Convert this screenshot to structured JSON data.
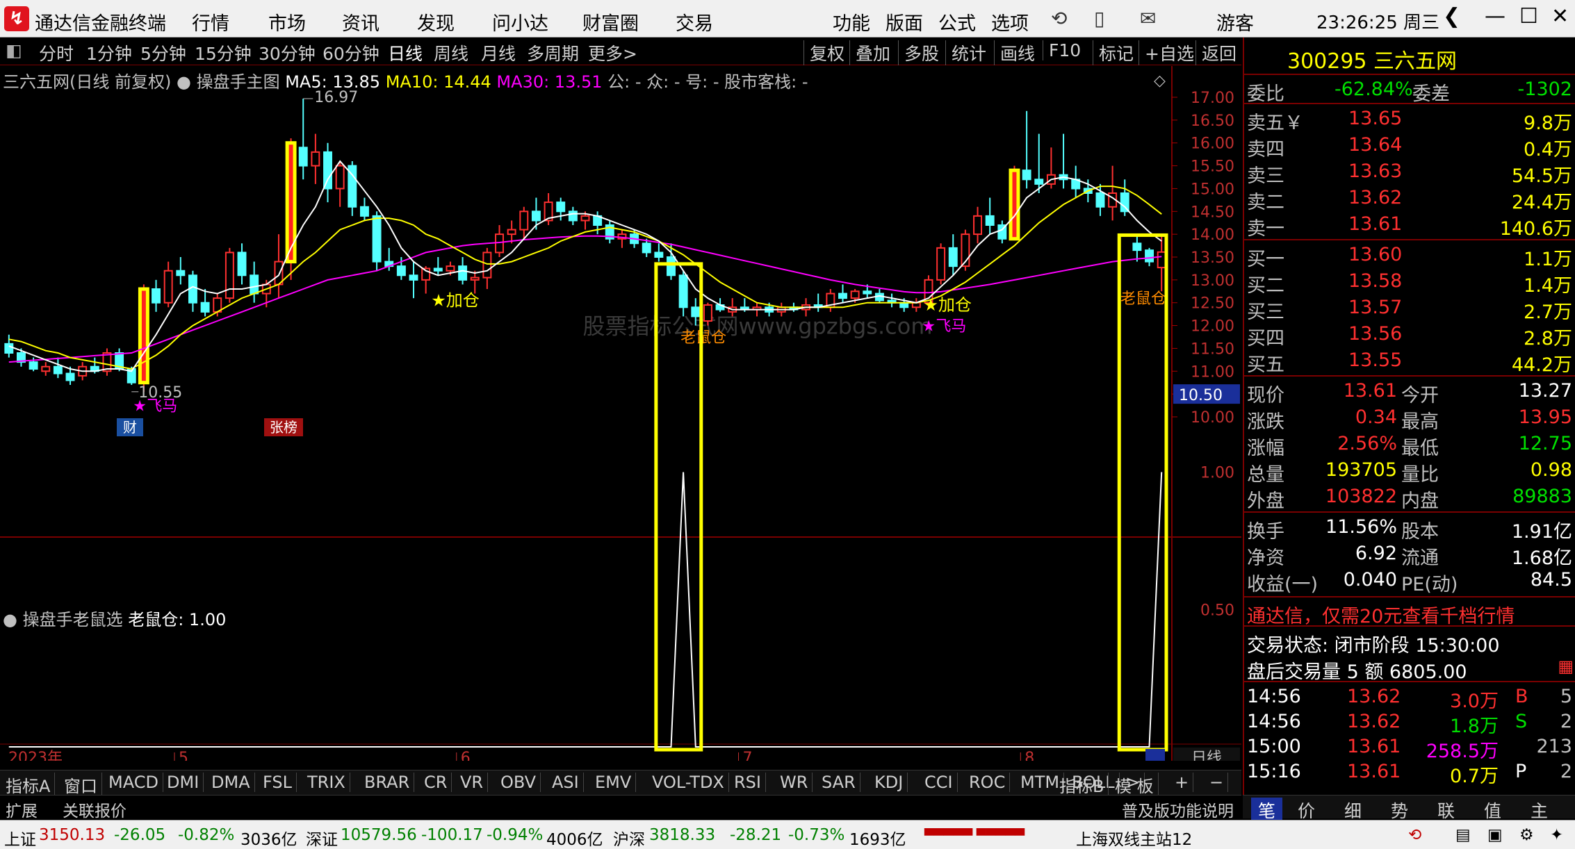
{
  "window": {
    "app_title": "通达信金融终端",
    "clock": "23:26:25 周三",
    "user": "游客"
  },
  "menu": {
    "left": [
      "行情",
      "市场",
      "资讯",
      "发现",
      "问小达",
      "财富圈",
      "交易"
    ],
    "right": [
      "功能",
      "版面",
      "公式",
      "选项"
    ]
  },
  "periods": [
    "分时",
    "1分钟",
    "5分钟",
    "15分钟",
    "30分钟",
    "60分钟",
    "日线",
    "周线",
    "月线",
    "多周期",
    "更多>"
  ],
  "active_period": "日线",
  "tools": [
    "复权",
    "叠加",
    "多股",
    "统计",
    "画线",
    "F10",
    "标记",
    "+自选",
    "返回"
  ],
  "info": {
    "name": "三六五网(日线 前复权)",
    "formula": "操盘手主图",
    "ma5": "MA5: 13.85",
    "ma10": "MA10: 14.44",
    "ma30": "MA30: 13.51",
    "extra": "公: - 众: - 号: - 股市客栈: -"
  },
  "sub_info": {
    "formula": "操盘手老鼠选",
    "value": "老鼠仓: 1.00"
  },
  "annotations": {
    "high_label": "16.97",
    "low_label": "10.55",
    "jiacang1": "★加仓",
    "jiacang2": "★加仓",
    "feima1": "飞马",
    "feima2": "飞马",
    "laoshu1": "老鼠仓",
    "laoshu2": "老鼠仓",
    "cai": "财",
    "zhangbang": "张榜",
    "watermark": "股票指标公式网www.gpzbgs.com",
    "current_price_tag": "10.50"
  },
  "price_axis": [
    "17.00",
    "16.50",
    "16.00",
    "15.50",
    "15.00",
    "14.50",
    "14.00",
    "13.50",
    "13.00",
    "12.50",
    "12.00",
    "11.50",
    "11.00",
    "10.50",
    "10.00"
  ],
  "sub_axis": [
    "1.00",
    "0.50"
  ],
  "date_axis": {
    "year": "2023年",
    "months": [
      "5",
      "6",
      "7",
      "8"
    ],
    "period_label": "日线"
  },
  "bottom_tabs": [
    "指标A",
    "窗口",
    "MACD",
    "DMI",
    "DMA",
    "FSL",
    "TRIX",
    "BRAR",
    "CR",
    "VR",
    "OBV",
    "ASI",
    "EMV",
    "VOL-TDX",
    "RSI",
    "WR",
    "SAR",
    "KDJ",
    "CCI",
    "ROC",
    "MTM",
    "BOLL",
    ">",
    "指标B",
    "模 板",
    "+",
    "−"
  ],
  "ext_bar": {
    "left": "扩展",
    "related": "关联报价",
    "right": "普及版功能说明"
  },
  "quote": {
    "code_name": "300295 三六五网",
    "weibi": {
      "label": "委比",
      "value": "-62.84%",
      "weicha_label": "委差",
      "weicha": "-1302"
    },
    "sells": [
      {
        "label": "卖五￥",
        "price": "13.65",
        "vol": "9.8万"
      },
      {
        "label": "卖四",
        "price": "13.64",
        "vol": "0.4万"
      },
      {
        "label": "卖三",
        "price": "13.63",
        "vol": "54.5万"
      },
      {
        "label": "卖二",
        "price": "13.62",
        "vol": "24.4万"
      },
      {
        "label": "卖一",
        "price": "13.61",
        "vol": "140.6万"
      }
    ],
    "buys": [
      {
        "label": "买一",
        "price": "13.60",
        "vol": "1.1万"
      },
      {
        "label": "买二",
        "price": "13.58",
        "vol": "1.4万"
      },
      {
        "label": "买三",
        "price": "13.57",
        "vol": "2.7万"
      },
      {
        "label": "买四",
        "price": "13.56",
        "vol": "2.8万"
      },
      {
        "label": "买五",
        "price": "13.55",
        "vol": "44.2万"
      }
    ],
    "stats": [
      {
        "l1": "现价",
        "v1": "13.61",
        "c1": "red",
        "l2": "今开",
        "v2": "13.27",
        "c2": "wht"
      },
      {
        "l1": "涨跌",
        "v1": "0.34",
        "c1": "red",
        "l2": "最高",
        "v2": "13.95",
        "c2": "red"
      },
      {
        "l1": "涨幅",
        "v1": "2.56%",
        "c1": "red",
        "l2": "最低",
        "v2": "12.75",
        "c2": "grn"
      },
      {
        "l1": "总量",
        "v1": "193705",
        "c1": "yel",
        "l2": "量比",
        "v2": "0.98",
        "c2": "yel"
      },
      {
        "l1": "外盘",
        "v1": "103822",
        "c1": "red",
        "l2": "内盘",
        "v2": "89883",
        "c2": "grn"
      }
    ],
    "stats2": [
      {
        "l1": "换手",
        "v1": "11.56%",
        "l2": "股本",
        "v2": "1.91亿"
      },
      {
        "l1": "净资",
        "v1": "6.92",
        "l2": "流通",
        "v2": "1.68亿"
      },
      {
        "l1": "收益(一)",
        "v1": "0.040",
        "l2": "PE(动)",
        "v2": "84.5"
      }
    ],
    "promo": "通达信，仅需20元查看千档行情",
    "trade_status": "交易状态: 闭市阶段 15:30:00",
    "after_hours": "盘后交易量 5 额 6805.00",
    "ticks": [
      {
        "time": "14:56",
        "price": "13.62",
        "vol": "3.0万",
        "dir": "B",
        "n": "5"
      },
      {
        "time": "14:56",
        "price": "13.62",
        "vol": "1.8万",
        "dir": "S",
        "n": "2"
      },
      {
        "time": "15:00",
        "price": "13.61",
        "vol": "258.5万",
        "dir": "",
        "n": "213"
      },
      {
        "time": "15:16",
        "price": "13.61",
        "vol": "0.7万",
        "dir": "P",
        "n": "2"
      }
    ]
  },
  "side_tabs": [
    "笔",
    "价",
    "细",
    "势",
    "联",
    "值",
    "主"
  ],
  "status": {
    "sh_label": "上证",
    "sh": "3150.13",
    "sh_chg": "-26.05",
    "sh_pct": "-0.82%",
    "sh_amt": "3036亿",
    "sz_label": "深证",
    "sz": "10579.56",
    "sz_chg": "-100.17",
    "sz_pct": "-0.94%",
    "sz_amt": "4006亿",
    "hs_label": "沪深",
    "hs": "3818.33",
    "hs_chg": "-28.21",
    "hs_pct": "-0.73%",
    "hs_amt": "1693亿",
    "server": "上海双线主站12"
  },
  "colors": {
    "up": "#ff3030",
    "down": "#54ffff",
    "ma5": "#ffffff",
    "ma10": "#ffff00",
    "ma30": "#ff00ff",
    "highlight": "#ffff00"
  },
  "chart_data": {
    "type": "candlestick",
    "price_range": [
      10.0,
      17.0
    ],
    "candles": [
      [
        11.6,
        11.8,
        11.3,
        11.4
      ],
      [
        11.4,
        11.5,
        11.1,
        11.2
      ],
      [
        11.2,
        11.3,
        11.0,
        11.05
      ],
      [
        11.0,
        11.2,
        10.9,
        11.1
      ],
      [
        11.1,
        11.3,
        10.85,
        10.95
      ],
      [
        10.95,
        11.1,
        10.7,
        10.8
      ],
      [
        10.9,
        11.2,
        10.8,
        11.1
      ],
      [
        11.1,
        11.3,
        10.95,
        11.0
      ],
      [
        11.0,
        11.5,
        10.9,
        11.4
      ],
      [
        11.4,
        11.5,
        11.0,
        11.05
      ],
      [
        11.05,
        11.1,
        10.7,
        10.75
      ],
      [
        10.75,
        12.9,
        10.55,
        12.8
      ],
      [
        12.8,
        13.0,
        12.3,
        12.5
      ],
      [
        12.5,
        13.4,
        12.4,
        13.2
      ],
      [
        13.2,
        13.5,
        12.9,
        13.1
      ],
      [
        13.1,
        13.2,
        12.3,
        12.5
      ],
      [
        12.5,
        12.8,
        12.2,
        12.3
      ],
      [
        12.3,
        12.7,
        12.2,
        12.6
      ],
      [
        12.6,
        13.7,
        12.5,
        13.6
      ],
      [
        13.6,
        13.8,
        12.9,
        13.1
      ],
      [
        13.1,
        13.4,
        12.5,
        12.7
      ],
      [
        12.7,
        13.0,
        12.4,
        12.9
      ],
      [
        12.9,
        14.0,
        12.6,
        13.4
      ],
      [
        13.4,
        16.1,
        13.0,
        16.0
      ],
      [
        15.9,
        16.97,
        15.2,
        15.5
      ],
      [
        15.5,
        16.2,
        15.1,
        15.8
      ],
      [
        15.8,
        16.0,
        14.7,
        15.0
      ],
      [
        15.0,
        15.6,
        14.6,
        15.5
      ],
      [
        15.5,
        15.6,
        14.4,
        14.6
      ],
      [
        14.6,
        14.8,
        14.3,
        14.4
      ],
      [
        14.4,
        14.5,
        13.2,
        13.4
      ],
      [
        13.4,
        13.7,
        13.2,
        13.3
      ],
      [
        13.3,
        13.5,
        13.0,
        13.1
      ],
      [
        13.1,
        13.4,
        12.6,
        13.0
      ],
      [
        13.0,
        13.3,
        12.7,
        13.25
      ],
      [
        13.25,
        13.5,
        13.1,
        13.2
      ],
      [
        13.2,
        13.4,
        13.1,
        13.3
      ],
      [
        13.3,
        13.5,
        12.9,
        13.0
      ],
      [
        13.0,
        13.2,
        12.7,
        13.05
      ],
      [
        13.05,
        13.7,
        12.8,
        13.6
      ],
      [
        13.6,
        14.2,
        13.5,
        14.0
      ],
      [
        14.0,
        14.3,
        13.8,
        14.1
      ],
      [
        14.1,
        14.6,
        13.9,
        14.5
      ],
      [
        14.5,
        14.8,
        14.1,
        14.3
      ],
      [
        14.3,
        14.9,
        14.2,
        14.7
      ],
      [
        14.7,
        14.8,
        14.3,
        14.5
      ],
      [
        14.5,
        14.6,
        14.2,
        14.3
      ],
      [
        14.3,
        14.5,
        14.1,
        14.4
      ],
      [
        14.4,
        14.5,
        14.0,
        14.2
      ],
      [
        14.2,
        14.3,
        13.8,
        13.9
      ],
      [
        13.9,
        14.1,
        13.7,
        14.0
      ],
      [
        14.0,
        14.1,
        13.7,
        13.8
      ],
      [
        13.8,
        13.9,
        13.5,
        13.6
      ],
      [
        13.6,
        13.8,
        13.4,
        13.5
      ],
      [
        13.5,
        13.8,
        13.0,
        13.1
      ],
      [
        13.1,
        13.2,
        12.2,
        12.4
      ],
      [
        12.4,
        12.6,
        12.0,
        12.2
      ],
      [
        12.1,
        12.5,
        12.0,
        12.45
      ],
      [
        12.45,
        12.6,
        12.3,
        12.35
      ],
      [
        12.3,
        12.6,
        12.2,
        12.4
      ],
      [
        12.4,
        12.6,
        12.3,
        12.35
      ],
      [
        12.35,
        12.5,
        12.2,
        12.4
      ],
      [
        12.4,
        12.5,
        12.2,
        12.3
      ],
      [
        12.3,
        12.5,
        12.2,
        12.4
      ],
      [
        12.4,
        12.5,
        12.3,
        12.35
      ],
      [
        12.35,
        12.6,
        12.2,
        12.45
      ],
      [
        12.45,
        12.7,
        12.3,
        12.4
      ],
      [
        12.4,
        12.8,
        12.3,
        12.7
      ],
      [
        12.7,
        12.9,
        12.5,
        12.6
      ],
      [
        12.6,
        12.8,
        12.5,
        12.75
      ],
      [
        12.75,
        12.9,
        12.6,
        12.7
      ],
      [
        12.7,
        12.8,
        12.5,
        12.55
      ],
      [
        12.55,
        12.7,
        12.4,
        12.5
      ],
      [
        12.5,
        12.6,
        12.3,
        12.4
      ],
      [
        12.4,
        12.6,
        12.3,
        12.5
      ],
      [
        12.5,
        13.1,
        12.4,
        13.0
      ],
      [
        13.0,
        13.8,
        12.9,
        13.7
      ],
      [
        13.7,
        14.0,
        13.1,
        13.3
      ],
      [
        13.3,
        14.1,
        13.2,
        14.0
      ],
      [
        14.0,
        14.6,
        13.8,
        14.4
      ],
      [
        14.4,
        14.8,
        14.0,
        14.2
      ],
      [
        14.2,
        14.3,
        13.8,
        13.9
      ],
      [
        13.9,
        15.5,
        13.9,
        15.4
      ],
      [
        15.4,
        16.7,
        15.0,
        15.2
      ],
      [
        15.2,
        16.2,
        14.9,
        15.1
      ],
      [
        15.1,
        15.9,
        15.0,
        15.3
      ],
      [
        15.3,
        16.2,
        15.0,
        15.2
      ],
      [
        15.2,
        15.5,
        14.8,
        15.0
      ],
      [
        15.0,
        15.2,
        14.7,
        14.9
      ],
      [
        14.9,
        15.1,
        14.4,
        14.6
      ],
      [
        14.6,
        15.5,
        14.3,
        14.9
      ],
      [
        14.9,
        15.2,
        14.4,
        14.5
      ],
      [
        13.8,
        13.95,
        13.4,
        13.65
      ],
      [
        13.65,
        13.7,
        13.3,
        13.4
      ],
      [
        13.27,
        13.95,
        12.75,
        13.61
      ]
    ],
    "ma5": [
      11.55,
      11.45,
      11.35,
      11.25,
      11.15,
      11.05,
      11.0,
      11.0,
      11.05,
      11.05,
      11.0,
      11.4,
      11.8,
      12.25,
      12.7,
      12.85,
      12.75,
      12.7,
      12.8,
      12.8,
      12.85,
      12.9,
      13.1,
      13.7,
      14.2,
      14.6,
      15.2,
      15.6,
      15.3,
      14.95,
      14.6,
      14.2,
      13.7,
      13.4,
      13.2,
      13.1,
      13.15,
      13.2,
      13.15,
      13.2,
      13.4,
      13.6,
      13.9,
      14.2,
      14.35,
      14.4,
      14.45,
      14.45,
      14.4,
      14.3,
      14.2,
      14.1,
      14.0,
      13.85,
      13.6,
      13.2,
      12.8,
      12.6,
      12.45,
      12.35,
      12.35,
      12.35,
      12.35,
      12.35,
      12.35,
      12.4,
      12.4,
      12.45,
      12.5,
      12.55,
      12.6,
      12.65,
      12.6,
      12.55,
      12.5,
      12.6,
      12.85,
      13.1,
      13.4,
      13.75,
      14.0,
      14.1,
      14.4,
      14.8,
      15.0,
      15.2,
      15.25,
      15.2,
      15.1,
      14.95,
      14.8,
      14.6,
      14.3,
      14.05,
      13.85
    ],
    "ma10": [
      11.7,
      11.65,
      11.55,
      11.45,
      11.4,
      11.3,
      11.25,
      11.2,
      11.15,
      11.1,
      11.05,
      11.2,
      11.35,
      11.55,
      11.8,
      12.0,
      12.15,
      12.3,
      12.45,
      12.6,
      12.7,
      12.8,
      12.9,
      13.15,
      13.4,
      13.6,
      13.85,
      14.1,
      14.2,
      14.3,
      14.35,
      14.35,
      14.3,
      14.2,
      14.0,
      13.9,
      13.75,
      13.6,
      13.45,
      13.35,
      13.35,
      13.4,
      13.5,
      13.6,
      13.7,
      13.85,
      13.95,
      14.05,
      14.1,
      14.15,
      14.1,
      14.05,
      13.95,
      13.85,
      13.7,
      13.55,
      13.35,
      13.15,
      12.95,
      12.8,
      12.65,
      12.5,
      12.45,
      12.4,
      12.4,
      12.4,
      12.4,
      12.4,
      12.4,
      12.45,
      12.5,
      12.5,
      12.5,
      12.5,
      12.5,
      12.55,
      12.65,
      12.8,
      12.95,
      13.15,
      13.35,
      13.55,
      13.75,
      14.0,
      14.25,
      14.45,
      14.65,
      14.8,
      14.95,
      15.05,
      15.05,
      15.0,
      14.85,
      14.65,
      14.44
    ],
    "ma30": [
      11.2,
      11.22,
      11.24,
      11.26,
      11.28,
      11.3,
      11.32,
      11.34,
      11.36,
      11.38,
      11.4,
      11.5,
      11.6,
      11.7,
      11.8,
      11.9,
      12.0,
      12.1,
      12.2,
      12.3,
      12.4,
      12.5,
      12.6,
      12.7,
      12.8,
      12.9,
      13.0,
      13.05,
      13.1,
      13.15,
      13.2,
      13.3,
      13.4,
      13.5,
      13.6,
      13.65,
      13.7,
      13.75,
      13.78,
      13.8,
      13.82,
      13.85,
      13.88,
      13.9,
      13.92,
      13.94,
      13.95,
      13.96,
      13.96,
      13.95,
      13.93,
      13.9,
      13.86,
      13.82,
      13.78,
      13.72,
      13.66,
      13.6,
      13.54,
      13.48,
      13.42,
      13.36,
      13.3,
      13.24,
      13.18,
      13.12,
      13.06,
      13.0,
      12.95,
      12.9,
      12.86,
      12.82,
      12.78,
      12.74,
      12.72,
      12.72,
      12.74,
      12.78,
      12.82,
      12.86,
      12.9,
      12.95,
      13.0,
      13.05,
      13.1,
      13.15,
      13.2,
      13.25,
      13.3,
      13.35,
      13.4,
      13.43,
      13.46,
      13.48,
      13.51
    ],
    "laoshu_signal": [
      0,
      0,
      0,
      0,
      0,
      0,
      0,
      0,
      0,
      0,
      0,
      0,
      0,
      0,
      0,
      0,
      0,
      0,
      0,
      0,
      0,
      0,
      0,
      0,
      0,
      0,
      0,
      0,
      0,
      0,
      0,
      0,
      0,
      0,
      0,
      0,
      0,
      0,
      0,
      0,
      0,
      0,
      0,
      0,
      0,
      0,
      0,
      0,
      0,
      0,
      0,
      0,
      0,
      0,
      0,
      1,
      0,
      0,
      0,
      0,
      0,
      0,
      0,
      0,
      0,
      0,
      0,
      0,
      0,
      0,
      0,
      0,
      0,
      0,
      0,
      0,
      0,
      0,
      0,
      0,
      0,
      0,
      0,
      0,
      0,
      0,
      0,
      0,
      0,
      0,
      0,
      0,
      0,
      0,
      1
    ],
    "sub_range": [
      0,
      1.1
    ]
  }
}
